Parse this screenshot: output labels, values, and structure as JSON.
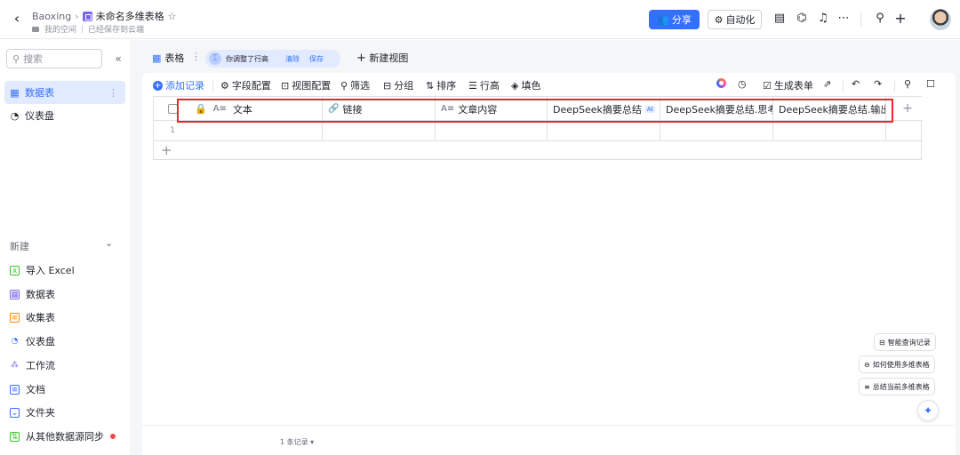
{
  "header": {
    "workspace": "Baoxing",
    "doc_title": "未命名多维表格",
    "location": "我的空间",
    "save_status": "已经保存到云端",
    "share_label": "分享",
    "automation_label": "自动化"
  },
  "sidebar": {
    "search_placeholder": "搜索",
    "items": [
      {
        "label": "数据表",
        "icon": "table-icon",
        "active": true
      },
      {
        "label": "仪表盘",
        "icon": "dashboard-icon",
        "active": false
      }
    ],
    "new_title": "新建",
    "new_items": [
      {
        "label": "导入 Excel",
        "icon": "excel-icon",
        "color": "#34c724"
      },
      {
        "label": "数据表",
        "icon": "table-icon",
        "color": "#7b67ee"
      },
      {
        "label": "收集表",
        "icon": "form-icon",
        "color": "#ff8800"
      },
      {
        "label": "仪表盘",
        "icon": "dashboard-icon",
        "color": "#3370ff"
      },
      {
        "label": "工作流",
        "icon": "workflow-icon",
        "color": "#7b67ee"
      },
      {
        "label": "文档",
        "icon": "doc-icon",
        "color": "#3370ff"
      },
      {
        "label": "文件夹",
        "icon": "folder-icon",
        "color": "#3370ff"
      },
      {
        "label": "从其他数据源同步",
        "icon": "sync-icon",
        "color": "#34c724"
      }
    ]
  },
  "view": {
    "tab_label": "表格",
    "notice_text": "你调整了行高",
    "notice_clear": "清除",
    "notice_save": "保存",
    "new_view_label": "新建视图"
  },
  "toolbar": {
    "add_record": "添加记录",
    "field_config": "字段配置",
    "view_config": "视图配置",
    "filter": "筛选",
    "group": "分组",
    "sort": "排序",
    "row_height": "行高",
    "fill_color": "填色",
    "generate_form": "生成表单"
  },
  "grid": {
    "columns": [
      {
        "label": "文本",
        "icon": "A≡"
      },
      {
        "label": "链接",
        "icon": "🔗"
      },
      {
        "label": "文章内容",
        "icon": "A≡"
      },
      {
        "label": "DeepSeek摘要总结",
        "icon": "",
        "ai_tag": "AI"
      },
      {
        "label": "DeepSeek摘要总结.思考...",
        "icon": ""
      },
      {
        "label": "DeepSeek摘要总结.输出...",
        "icon": ""
      }
    ],
    "rows": [
      {
        "number": "1"
      }
    ],
    "record_count": "1 条记录 ▾"
  },
  "assistant": {
    "query_records": "智能查询记录",
    "how_to_use": "如何使用多维表格",
    "summarize": "总结当前多维表格"
  },
  "colors": {
    "accent": "#3370ff",
    "highlight": "#e5292c"
  }
}
